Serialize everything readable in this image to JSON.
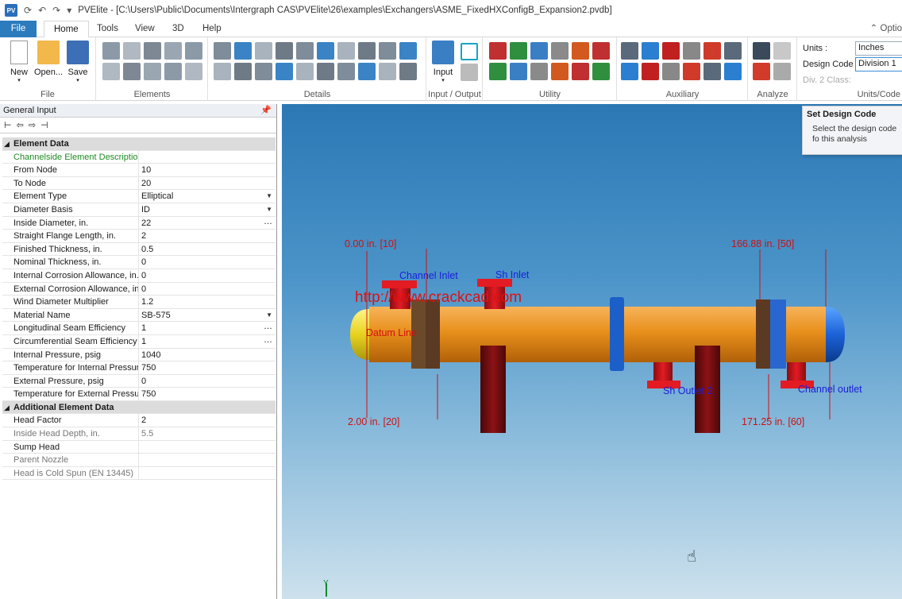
{
  "titlebar": {
    "app_icon": "PV",
    "title": "PVElite - [C:\\Users\\Public\\Documents\\Intergraph CAS\\PVElite\\26\\examples\\Exchangers\\ASME_FixedHXConfigB_Expansion2.pvdb]"
  },
  "tabs": {
    "file": "File",
    "home": "Home",
    "tools": "Tools",
    "view": "View",
    "three_d": "3D",
    "help": "Help",
    "options": "Optio"
  },
  "ribbon": {
    "new": "New",
    "open": "Open...",
    "save": "Save",
    "file_group": "File",
    "elements_group": "Elements",
    "details_group": "Details",
    "input": "Input",
    "io_group": "Input / Output",
    "utility_group": "Utility",
    "auxiliary_group": "Auxiliary",
    "analyze_group": "Analyze",
    "units_group": "Units/Code",
    "units_label": "Units :",
    "units_value": "Inches",
    "design_label": "Design Code :",
    "design_value": "Division 1",
    "div2_label": "Div. 2 Class:"
  },
  "tooltip": {
    "title": "Set Design Code",
    "text": "Select the design code fo this analysis"
  },
  "panel": {
    "header": "General Input"
  },
  "element_data": {
    "category": "Element Data",
    "rows": [
      {
        "k": "Channelside Element Description",
        "v": ""
      },
      {
        "k": "From Node",
        "v": "10"
      },
      {
        "k": "To Node",
        "v": "20"
      },
      {
        "k": "Element Type",
        "v": "Elliptical"
      },
      {
        "k": "Diameter Basis",
        "v": "ID"
      },
      {
        "k": "Inside Diameter, in.",
        "v": "22"
      },
      {
        "k": "Straight Flange Length, in.",
        "v": "2"
      },
      {
        "k": "Finished Thickness, in.",
        "v": "0.5"
      },
      {
        "k": "Nominal Thickness, in.",
        "v": "0"
      },
      {
        "k": "Internal Corrosion Allowance, in.",
        "v": "0"
      },
      {
        "k": "External Corrosion Allowance, in.",
        "v": "0"
      },
      {
        "k": "Wind Diameter Multiplier",
        "v": "1.2"
      },
      {
        "k": "Material Name",
        "v": "SB-575"
      },
      {
        "k": "Longitudinal Seam Efficiency",
        "v": "1"
      },
      {
        "k": "Circumferential Seam Efficiency",
        "v": "1"
      },
      {
        "k": "Internal Pressure, psig",
        "v": "1040"
      },
      {
        "k": "Temperature for Internal Pressure,",
        "v": "750"
      },
      {
        "k": "External Pressure, psig",
        "v": "0"
      },
      {
        "k": "Temperature for External Pressure,",
        "v": "750"
      }
    ]
  },
  "additional_data": {
    "category": "Additional Element Data",
    "rows": [
      {
        "k": "Head Factor",
        "v": "2"
      },
      {
        "k": "Inside Head Depth, in.",
        "v": "5.5"
      },
      {
        "k": "Sump Head",
        "v": ""
      },
      {
        "k": "Parent Nozzle",
        "v": ""
      },
      {
        "k": "Head is Cold Spun (EN 13445)",
        "v": ""
      }
    ]
  },
  "viewport": {
    "dim_tl": "0.00 in.  [10]",
    "dim_tr": "166.88 in.  [50]",
    "dim_bl": "2.00 in.  [20]",
    "dim_br": "171.25 in.  [60]",
    "channel_inlet": "Channel Inlet",
    "sh_inlet": "Sh Inlet",
    "sh_outlet": "Sh Outlet 2",
    "channel_outlet": "Channel outlet",
    "datum_line": "Datum Line",
    "watermark": "http://www.crackcad.com",
    "axis_y": "Y"
  },
  "colors": {
    "accent": "#2b7bbd",
    "vessel": "#e8901c",
    "nozzle": "#e31b23",
    "dim": "#d01010",
    "label": "#1a20d8"
  }
}
